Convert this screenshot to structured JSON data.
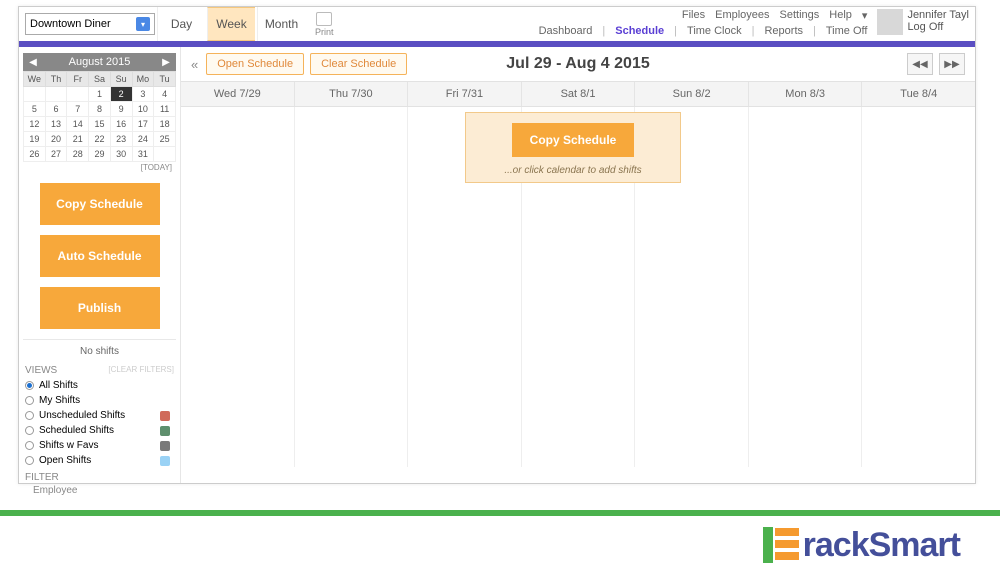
{
  "location": "Downtown Diner",
  "views": {
    "day": "Day",
    "week": "Week",
    "month": "Month",
    "active": "week"
  },
  "print": "Print",
  "top_links": {
    "files": "Files",
    "employees": "Employees",
    "settings": "Settings",
    "help": "Help"
  },
  "main_nav": {
    "dashboard": "Dashboard",
    "schedule": "Schedule",
    "time_clock": "Time Clock",
    "reports": "Reports",
    "time_off": "Time Off",
    "active": "schedule"
  },
  "user": {
    "name": "Jennifer Tayl",
    "logoff": "Log Off"
  },
  "mini_cal": {
    "title": "August 2015",
    "dow": [
      "We",
      "Th",
      "Fr",
      "Sa",
      "Su",
      "Mo",
      "Tu"
    ],
    "rows": [
      [
        "",
        "",
        "",
        "1",
        "2",
        "3",
        "4"
      ],
      [
        "5",
        "6",
        "7",
        "8",
        "9",
        "10",
        "11"
      ],
      [
        "12",
        "13",
        "14",
        "15",
        "16",
        "17",
        "18"
      ],
      [
        "19",
        "20",
        "21",
        "22",
        "23",
        "24",
        "25"
      ],
      [
        "26",
        "27",
        "28",
        "29",
        "30",
        "31",
        ""
      ]
    ],
    "selected": "2",
    "today": "[TODAY]"
  },
  "sidebar_buttons": {
    "copy": "Copy Schedule",
    "auto": "Auto Schedule",
    "publish": "Publish"
  },
  "no_shifts": "No shifts",
  "views_panel": {
    "head": "VIEWS",
    "clear": "[CLEAR FILTERS]",
    "options": [
      {
        "label": "All Shifts",
        "selected": true
      },
      {
        "label": "My Shifts",
        "selected": false
      },
      {
        "label": "Unscheduled Shifts",
        "selected": false,
        "chip": "#d06a5a"
      },
      {
        "label": "Scheduled Shifts",
        "selected": false,
        "chip": "#5e8f6d"
      },
      {
        "label": "Shifts w Favs",
        "selected": false,
        "chip": "#7a7a7a"
      },
      {
        "label": "Open Shifts",
        "selected": false,
        "chip": "#9ad2f5"
      }
    ]
  },
  "filter": {
    "head": "FILTER",
    "item": "Employee"
  },
  "toolbar": {
    "open": "Open Schedule",
    "clear": "Clear Schedule"
  },
  "date_range": "Jul 29 - Aug 4 2015",
  "days": [
    "Wed 7/29",
    "Thu 7/30",
    "Fri 7/31",
    "Sat 8/1",
    "Sun 8/2",
    "Mon 8/3",
    "Tue 8/4"
  ],
  "callout": {
    "button": "Copy Schedule",
    "hint": "...or click calendar to add shifts"
  },
  "brand": "rackSmart"
}
